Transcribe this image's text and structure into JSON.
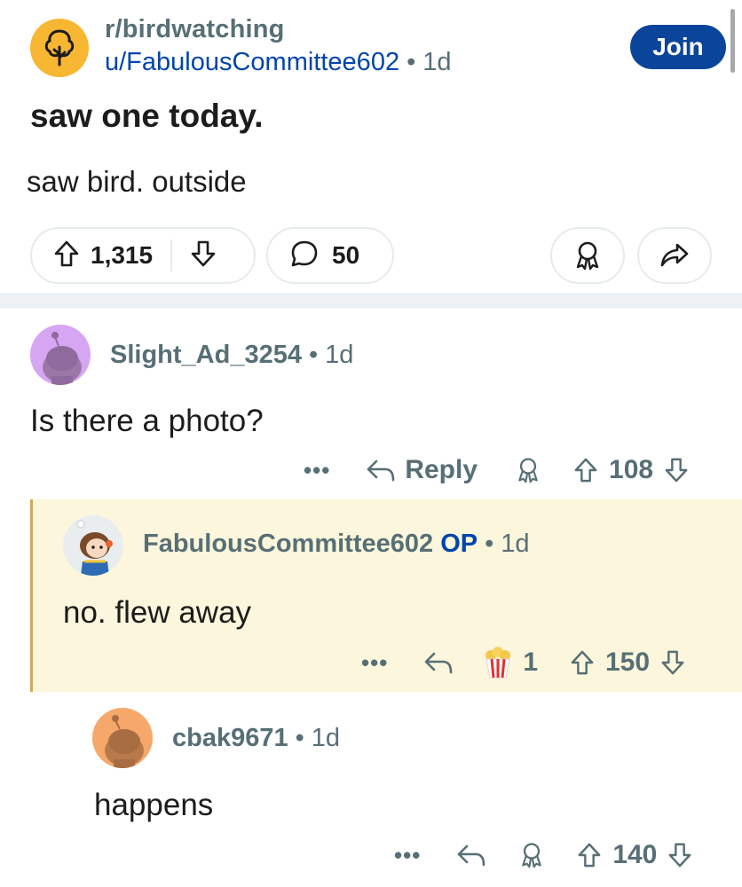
{
  "post": {
    "subreddit": "r/birdwatching",
    "author": "u/FabulousCommittee602",
    "separator": "•",
    "age": "1d",
    "join_label": "Join",
    "title": "saw one today.",
    "body": "saw bird. outside",
    "upvotes": "1,315",
    "comments": "50",
    "colors": {
      "join_bg": "#0a449b",
      "subreddit_avatar": "#f7b733",
      "link_blue": "#0045ac"
    }
  },
  "comments": [
    {
      "username": "Slight_Ad_3254",
      "separator": "•",
      "age": "1d",
      "text": "Is there a photo?",
      "more": "•••",
      "reply_label": "Reply",
      "score": "108",
      "avatar_color": "#d7a6f2"
    },
    {
      "username": "FabulousCommittee602",
      "op_badge": "OP",
      "separator": "•",
      "age": "1d",
      "text": "no. flew away",
      "more": "•••",
      "award_count": "1",
      "score": "150",
      "highlight_bg": "#fcf6dc"
    },
    {
      "username": "cbak9671",
      "separator": "•",
      "age": "1d",
      "text": "happens",
      "more": "•••",
      "score": "140",
      "avatar_color": "#f6a86a"
    }
  ]
}
